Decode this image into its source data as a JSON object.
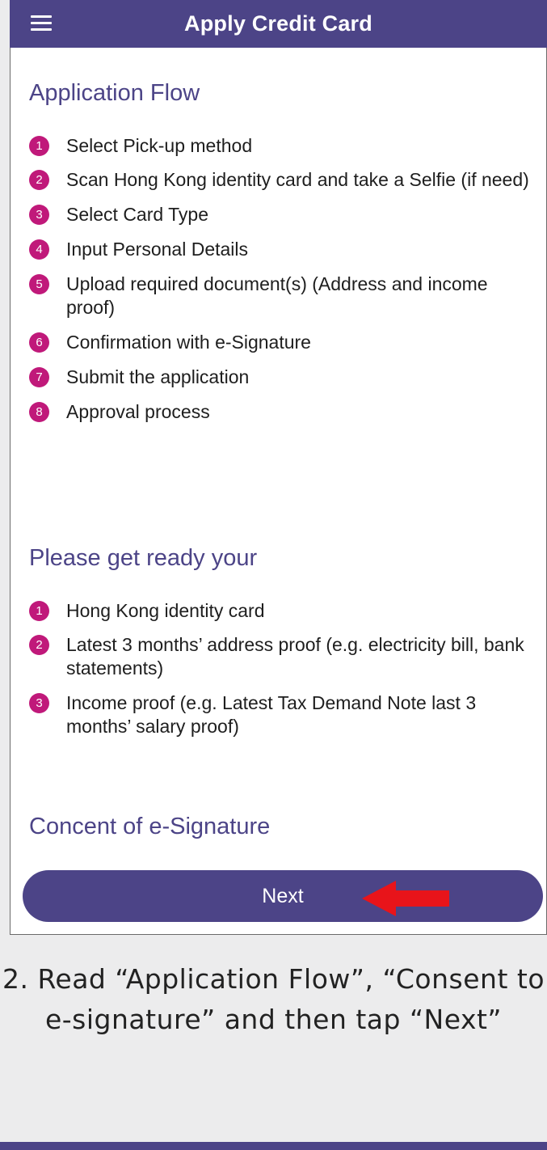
{
  "header": {
    "title": "Apply Credit Card",
    "menu_icon": "hamburger-menu-icon"
  },
  "application_flow": {
    "title": "Application Flow",
    "steps": [
      {
        "n": "1",
        "text": "Select Pick-up method"
      },
      {
        "n": "2",
        "text": "Scan Hong Kong identity card and take a Selfie (if need)"
      },
      {
        "n": "3",
        "text": "Select Card Type"
      },
      {
        "n": "4",
        "text": "Input Personal Details"
      },
      {
        "n": "5",
        "text": "Upload required document(s) (Address and income proof)"
      },
      {
        "n": "6",
        "text": "Confirmation with e-Signature"
      },
      {
        "n": "7",
        "text": "Submit the application"
      },
      {
        "n": "8",
        "text": "Approval process"
      }
    ]
  },
  "get_ready": {
    "title": "Please get ready your",
    "items": [
      {
        "n": "1",
        "text": "Hong Kong identity card"
      },
      {
        "n": "2",
        "text": "Latest 3 months’ address proof (e.g. electricity bill, bank statements)"
      },
      {
        "n": "3",
        "text": "Income proof (e.g. Latest Tax Demand Note last 3 months’ salary proof)"
      }
    ]
  },
  "consent": {
    "title": "Concent of e-Signature"
  },
  "next_button": {
    "label": "Next"
  },
  "caption": "2. Read “Application Flow”, “Consent to e-signature” and then tap “Next”",
  "colors": {
    "brand": "#4c4487",
    "step_badge": "#c0197a",
    "arrow": "#e8141a"
  }
}
